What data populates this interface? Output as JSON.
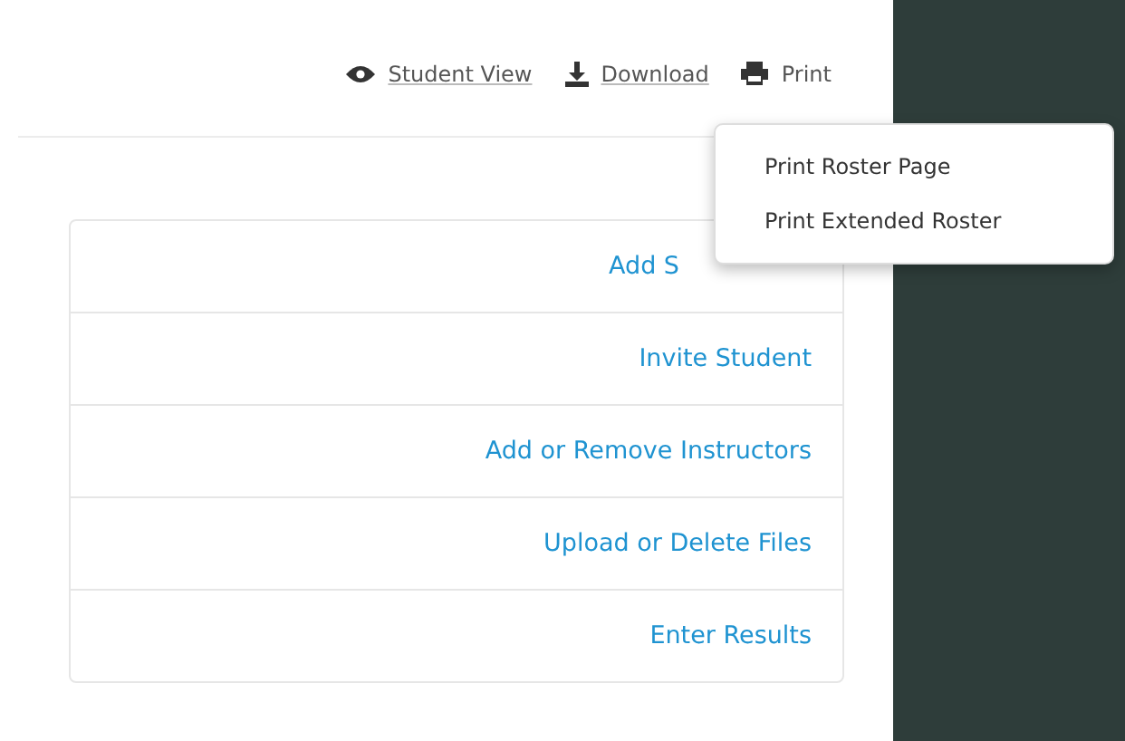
{
  "toolbar": [
    {
      "kind": "eye",
      "label": "Student View",
      "link": true
    },
    {
      "kind": "download",
      "label": "Download",
      "link": true
    },
    {
      "kind": "print",
      "label": "Print",
      "link": false
    }
  ],
  "print_menu": {
    "items": [
      "Print Roster Page",
      "Print Extended Roster"
    ]
  },
  "actions": [
    {
      "label": "Add S",
      "cut_by_menu": true
    },
    {
      "label": "Invite Student",
      "cut_by_menu": false
    },
    {
      "label": "Add or Remove Instructors",
      "cut_by_menu": false
    },
    {
      "label": "Upload or Delete Files",
      "cut_by_menu": false
    },
    {
      "label": "Enter Results",
      "cut_by_menu": false
    }
  ]
}
